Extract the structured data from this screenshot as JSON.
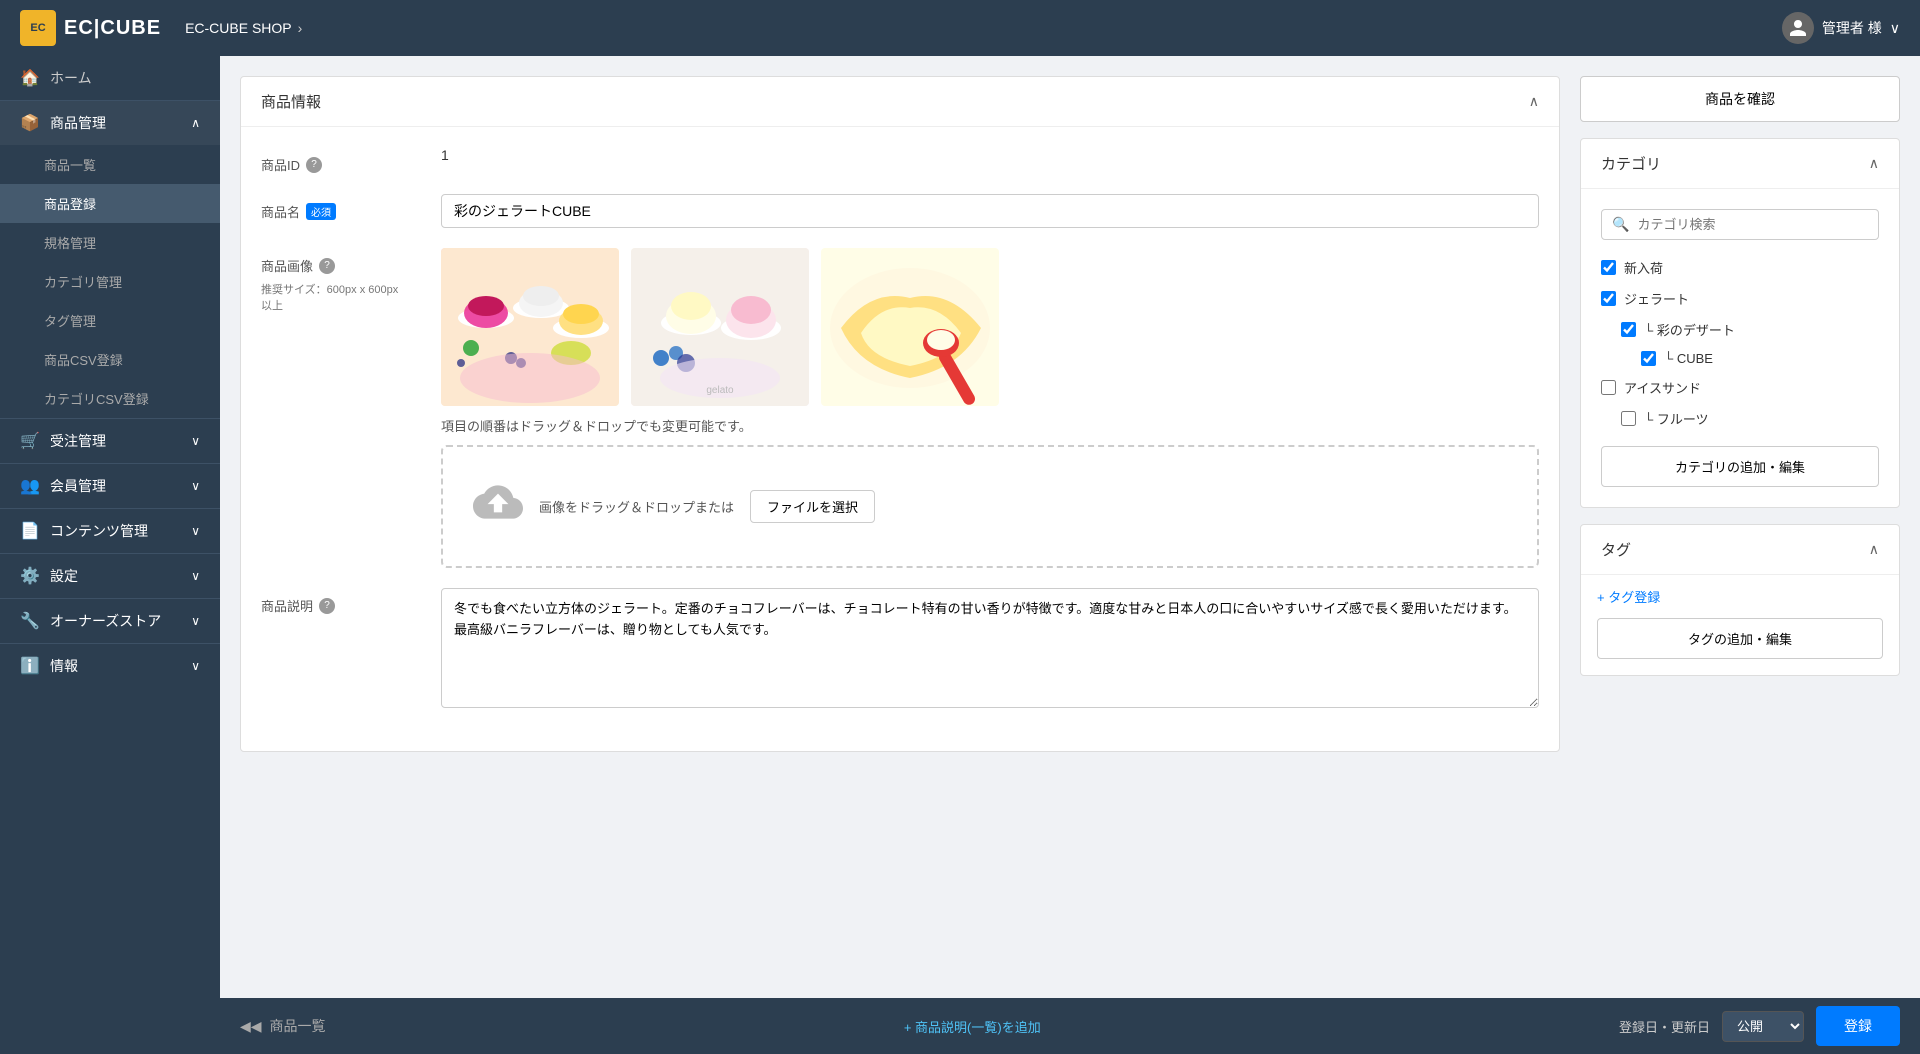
{
  "header": {
    "logo_text": "EC|CUBE",
    "logo_icon": "EC",
    "shop_name": "EC-CUBE SHOP",
    "shop_chevron": "›",
    "user_name": "管理者 様",
    "user_chevron": "∨"
  },
  "sidebar": {
    "items": [
      {
        "id": "home",
        "label": "ホーム",
        "icon": "🏠",
        "type": "link"
      },
      {
        "id": "product-mgmt",
        "label": "商品管理",
        "icon": "📦",
        "type": "section",
        "expanded": true
      },
      {
        "id": "product-list",
        "label": "商品一覧",
        "type": "subitem"
      },
      {
        "id": "product-register",
        "label": "商品登録",
        "type": "subitem",
        "active": true
      },
      {
        "id": "spec-mgmt",
        "label": "規格管理",
        "type": "subitem"
      },
      {
        "id": "category-mgmt",
        "label": "カテゴリ管理",
        "type": "subitem"
      },
      {
        "id": "tag-mgmt",
        "label": "タグ管理",
        "type": "subitem"
      },
      {
        "id": "product-csv",
        "label": "商品CSV登録",
        "type": "subitem"
      },
      {
        "id": "category-csv",
        "label": "カテゴリCSV登録",
        "type": "subitem"
      },
      {
        "id": "order-mgmt",
        "label": "受注管理",
        "icon": "🛒",
        "type": "section"
      },
      {
        "id": "member-mgmt",
        "label": "会員管理",
        "icon": "👥",
        "type": "section"
      },
      {
        "id": "content-mgmt",
        "label": "コンテンツ管理",
        "icon": "📄",
        "type": "section"
      },
      {
        "id": "settings",
        "label": "設定",
        "icon": "⚙️",
        "type": "section"
      },
      {
        "id": "owner-store",
        "label": "オーナーズストア",
        "icon": "🔧",
        "type": "section"
      },
      {
        "id": "info",
        "label": "情報",
        "icon": "ℹ️",
        "type": "section"
      }
    ]
  },
  "product_info": {
    "section_title": "商品情報",
    "product_id_label": "商品ID",
    "product_id_value": "1",
    "product_name_label": "商品名",
    "product_name_required": "必須",
    "product_name_value": "彩のジェラートCUBE",
    "product_image_label": "商品画像",
    "product_image_note": "推奨サイズ：600px x 600px\n以上",
    "dnd_note": "項目の順番はドラッグ＆ドロップでも変更可能です。",
    "upload_text": "画像をドラッグ＆ドロップまたは",
    "file_select_label": "ファイルを選択",
    "description_label": "商品説明",
    "description_value": "冬でも食べたい立方体のジェラート。定番のチョコフレーバーは、チョコレート特有の甘い香りが特徴です。適度な甘みと日本人の口に合いやすいサイズ感で長く愛用いただけます。\n最高級バニラフレーバーは、贈り物としても人気です。"
  },
  "right_panel": {
    "confirm_button": "商品を確認",
    "category_section_title": "カテゴリ",
    "category_search_placeholder": "カテゴリ検索",
    "categories": [
      {
        "id": "new-arrival",
        "label": "新入荷",
        "checked": true,
        "level": 0
      },
      {
        "id": "gelato",
        "label": "ジェラート",
        "checked": true,
        "level": 0
      },
      {
        "id": "colored-dessert",
        "label": "└ 彩のデザート",
        "checked": true,
        "level": 1
      },
      {
        "id": "cube",
        "label": "└ CUBE",
        "checked": true,
        "level": 2
      },
      {
        "id": "ice-sand",
        "label": "アイスサンド",
        "checked": false,
        "level": 0
      },
      {
        "id": "fruits",
        "label": "└ フルーツ",
        "checked": false,
        "level": 1
      }
    ],
    "category_add_button": "カテゴリの追加・編集",
    "tag_section_title": "タグ",
    "tag_register_label": "+ タグ登録",
    "tag_add_button": "タグの追加・編集"
  },
  "bottom_bar": {
    "back_label": "商品一覧",
    "add_desc_label": "+ 商品説明(一覧)を追加",
    "publish_label": "登録日・更新日",
    "publish_option": "公開",
    "register_button": "登録"
  }
}
